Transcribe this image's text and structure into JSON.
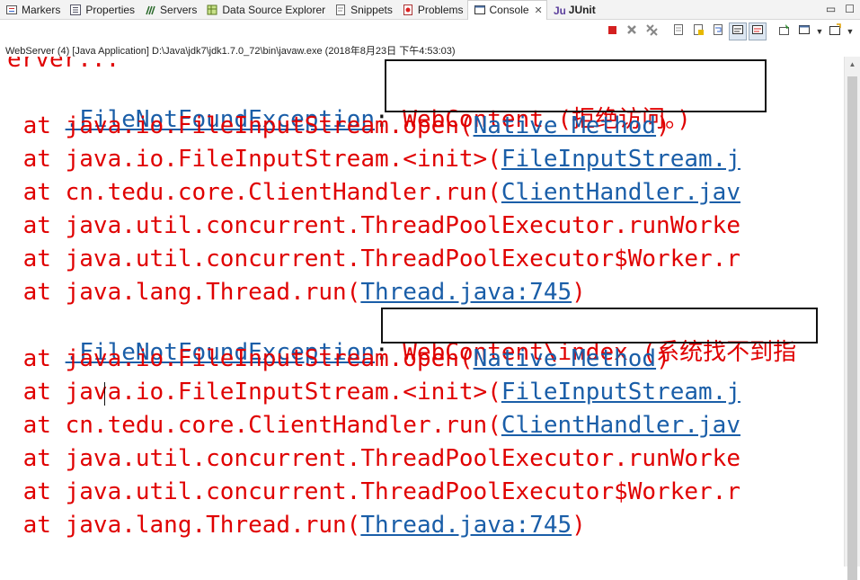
{
  "tabs": [
    {
      "label": "Markers",
      "icon": "markers-icon"
    },
    {
      "label": "Properties",
      "icon": "properties-icon"
    },
    {
      "label": "Servers",
      "icon": "servers-icon"
    },
    {
      "label": "Data Source Explorer",
      "icon": "data-source-icon"
    },
    {
      "label": "Snippets",
      "icon": "snippets-icon"
    },
    {
      "label": "Problems",
      "icon": "problems-icon"
    },
    {
      "label": "Console",
      "icon": "console-icon",
      "active": true,
      "close": "✕"
    },
    {
      "label": "JUnit",
      "icon": "junit-icon",
      "bold": true
    }
  ],
  "window_controls": {
    "minimize": "▭",
    "maximize": "☐"
  },
  "toolbar": [
    {
      "name": "terminate-button",
      "icon": "terminate-icon",
      "color": "#d42020"
    },
    {
      "name": "remove-launch-button",
      "icon": "remove-launch-icon"
    },
    {
      "name": "remove-all-terminated-button",
      "icon": "remove-all-icon"
    },
    {
      "name": "clear-console-button",
      "icon": "clear-console-icon"
    },
    {
      "name": "scroll-lock-button",
      "icon": "scroll-lock-icon"
    },
    {
      "name": "word-wrap-button",
      "icon": "word-wrap-icon"
    },
    {
      "name": "show-on-stdout-button",
      "icon": "show-stdout-icon",
      "selected": true
    },
    {
      "name": "show-on-stderr-button",
      "icon": "show-stderr-icon",
      "selected": true
    },
    {
      "name": "pin-console-button",
      "icon": "pin-icon"
    },
    {
      "name": "display-console-button",
      "icon": "display-console-icon"
    },
    {
      "name": "open-console-button",
      "icon": "open-console-icon"
    }
  ],
  "launch_info": "WebServer (4) [Java Application] D:\\Java\\jdk7\\jdk1.7.0_72\\bin\\javaw.exe (2018年8月23日 下午4:53:03)",
  "console": {
    "first_line": "erver...",
    "exception_text": ".FileNotFoundException",
    "colon": ":",
    "message_1": " WebContent (拒绝访问。)",
    "message_2": " WebContent\\index (系统找不到指",
    "frames": [
      {
        "pre": " at java.io.FileInputStream.open(",
        "link": "Native Method",
        "post": ")"
      },
      {
        "pre": " at java.io.FileInputStream.<init>(",
        "link": "FileInputStream.j",
        "post": ""
      },
      {
        "pre": " at cn.tedu.core.ClientHandler.run(",
        "link": "ClientHandler.jav",
        "post": ""
      },
      {
        "pre": " at java.util.concurrent.ThreadPoolExecutor.runWorke",
        "link": "",
        "post": ""
      },
      {
        "pre": " at java.util.concurrent.ThreadPoolExecutor$Worker.r",
        "link": "",
        "post": ""
      },
      {
        "pre": " at java.lang.Thread.run(",
        "link": "Thread.java:745",
        "post": ")"
      }
    ]
  },
  "colors": {
    "error": "#e00000",
    "link": "#1a5ea8",
    "tab_bg": "#f3f3f3"
  }
}
